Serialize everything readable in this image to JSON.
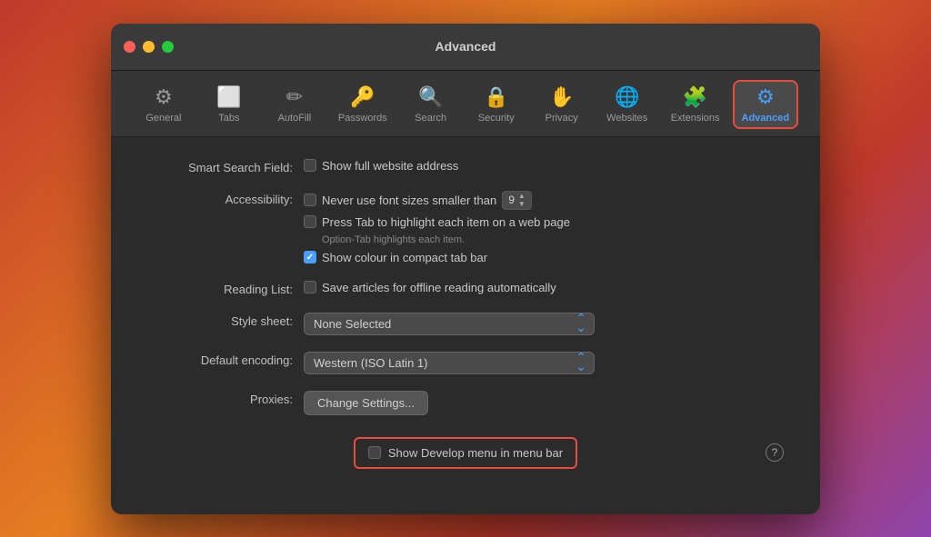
{
  "window": {
    "title": "Advanced",
    "traffic_lights": [
      "close",
      "minimize",
      "maximize"
    ]
  },
  "toolbar": {
    "items": [
      {
        "id": "general",
        "label": "General",
        "icon": "⚙️"
      },
      {
        "id": "tabs",
        "label": "Tabs",
        "icon": "⬜"
      },
      {
        "id": "autofill",
        "label": "AutoFill",
        "icon": "✏️"
      },
      {
        "id": "passwords",
        "label": "Passwords",
        "icon": "🔑"
      },
      {
        "id": "search",
        "label": "Search",
        "icon": "🔍"
      },
      {
        "id": "security",
        "label": "Security",
        "icon": "🔒"
      },
      {
        "id": "privacy",
        "label": "Privacy",
        "icon": "✋"
      },
      {
        "id": "websites",
        "label": "Websites",
        "icon": "🌐"
      },
      {
        "id": "extensions",
        "label": "Extensions",
        "icon": "🧩"
      },
      {
        "id": "advanced",
        "label": "Advanced",
        "icon": "⚙️"
      }
    ]
  },
  "content": {
    "smart_search": {
      "label": "Smart Search Field:",
      "option": "Show full website address"
    },
    "accessibility": {
      "label": "Accessibility:",
      "option1": "Never use font sizes smaller than",
      "font_size": "9",
      "option2": "Press Tab to highlight each item on a web page",
      "hint": "Option-Tab highlights each item.",
      "option3": "Show colour in compact tab bar",
      "option3_checked": true
    },
    "reading_list": {
      "label": "Reading List:",
      "option": "Save articles for offline reading automatically"
    },
    "style_sheet": {
      "label": "Style sheet:",
      "value": "None Selected"
    },
    "default_encoding": {
      "label": "Default encoding:",
      "value": "Western (ISO Latin 1)"
    },
    "proxies": {
      "label": "Proxies:",
      "button": "Change Settings..."
    },
    "develop_menu": {
      "label": "Show Develop menu in menu bar"
    },
    "help_icon": "?"
  }
}
